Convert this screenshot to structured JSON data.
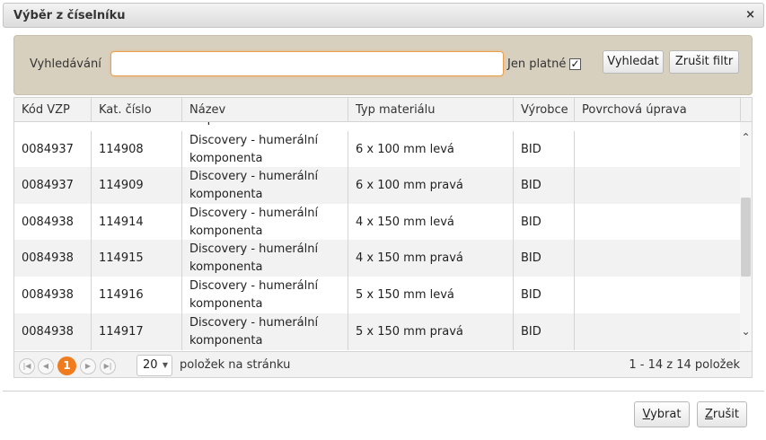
{
  "dialog": {
    "title": "Výběr z číselníku",
    "close_glyph": "×"
  },
  "filter": {
    "search_label": "Vyhledávání",
    "search_value": "",
    "valid_label": "Jen platné",
    "valid_checked_glyph": "✓",
    "search_button": "Vyhledat",
    "clear_button": "Zrušit filtr"
  },
  "grid": {
    "columns": [
      "Kód VZP",
      "Kat. číslo",
      "Název",
      "Typ materiálu",
      "Výrobce",
      "Povrchová úprava"
    ],
    "partial_top_text": "komponenta",
    "rows": [
      {
        "kod": "0084937",
        "kat": "114908",
        "nazev": "Discovery - humerální komponenta",
        "typ": "6 x 100 mm levá",
        "vyrobce": "BID",
        "povrch": ""
      },
      {
        "kod": "0084937",
        "kat": "114909",
        "nazev": "Discovery - humerální komponenta",
        "typ": "6 x 100 mm pravá",
        "vyrobce": "BID",
        "povrch": ""
      },
      {
        "kod": "0084938",
        "kat": "114914",
        "nazev": "Discovery - humerální komponenta",
        "typ": "4 x 150 mm levá",
        "vyrobce": "BID",
        "povrch": ""
      },
      {
        "kod": "0084938",
        "kat": "114915",
        "nazev": "Discovery - humerální komponenta",
        "typ": "4 x 150 mm pravá",
        "vyrobce": "BID",
        "povrch": ""
      },
      {
        "kod": "0084938",
        "kat": "114916",
        "nazev": "Discovery - humerální komponenta",
        "typ": "5 x 150 mm levá",
        "vyrobce": "BID",
        "povrch": ""
      },
      {
        "kod": "0084938",
        "kat": "114917",
        "nazev": "Discovery - humerální komponenta",
        "typ": "5 x 150 mm pravá",
        "vyrobce": "BID",
        "povrch": ""
      }
    ]
  },
  "pager": {
    "first_icon": "first-page-icon",
    "prev_icon": "prev-page-icon",
    "current_page": "1",
    "next_icon": "next-page-icon",
    "last_icon": "last-page-icon",
    "page_size": "20",
    "page_size_label": "položek na stránku",
    "info": "1 - 14 z 14 položek"
  },
  "footer": {
    "select_button_key": "V",
    "select_button_rest": "ybrat",
    "cancel_button_key": "Z",
    "cancel_button_rest": "rušit"
  },
  "colors": {
    "accent": "#ef7c1f",
    "filter_bg": "#d8d0bf",
    "alt_row": "#f2f2f2"
  }
}
